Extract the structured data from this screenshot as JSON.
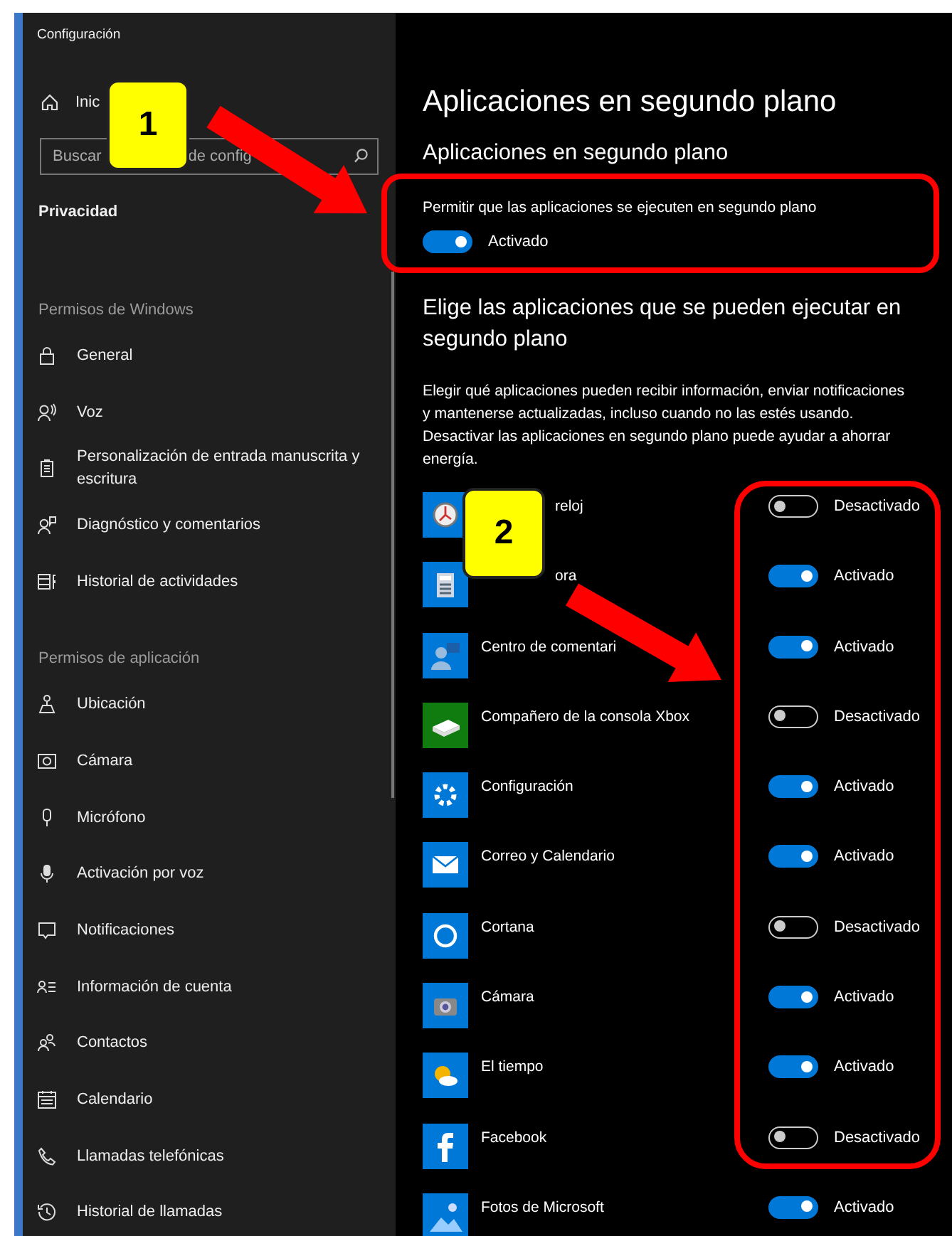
{
  "window": {
    "title": "Configuración"
  },
  "sidebar": {
    "home": {
      "label": "Inic"
    },
    "search": {
      "visible_text": [
        "Buscar",
        "de config"
      ]
    },
    "section": "Privacidad",
    "groups": [
      {
        "heading": "Permisos de Windows",
        "items": [
          "General",
          "Voz",
          "Personalización de entrada manuscrita y escritura",
          "Diagnóstico y comentarios",
          "Historial de actividades"
        ]
      },
      {
        "heading": "Permisos de aplicación",
        "items": [
          "Ubicación",
          "Cámara",
          "Micrófono",
          "Activación por voz",
          "Notificaciones",
          "Información de cuenta",
          "Contactos",
          "Calendario",
          "Llamadas telefónicas",
          "Historial de llamadas"
        ]
      }
    ]
  },
  "main": {
    "title": "Aplicaciones en segundo plano",
    "subtitle": "Aplicaciones en segundo plano",
    "master": {
      "label": "Permitir que las aplicaciones se ejecuten en segundo plano",
      "on": true,
      "state_text": "Activado"
    },
    "heading": "Elige las aplicaciones que se pueden ejecutar en segundo plano",
    "description": "Elegir qué aplicaciones pueden recibir información, enviar notificaciones y mantenerse actualizadas, incluso cuando no las estés usando. Desactivar las aplicaciones en segundo plano puede ayudar a ahorrar energía.",
    "apps": [
      {
        "name": "reloj",
        "covered": true,
        "on": false,
        "state_text": "Desactivado"
      },
      {
        "name": "ora",
        "covered": true,
        "on": true,
        "state_text": "Activado"
      },
      {
        "name": "Centro de comentari",
        "covered": false,
        "on": true,
        "state_text": "Activado"
      },
      {
        "name": "Compañero de la consola Xbox",
        "covered": false,
        "on": false,
        "state_text": "Desactivado"
      },
      {
        "name": "Configuración",
        "covered": false,
        "on": true,
        "state_text": "Activado"
      },
      {
        "name": "Correo y Calendario",
        "covered": false,
        "on": true,
        "state_text": "Activado"
      },
      {
        "name": "Cortana",
        "covered": false,
        "on": false,
        "state_text": "Desactivado"
      },
      {
        "name": "Cámara",
        "covered": false,
        "on": true,
        "state_text": "Activado"
      },
      {
        "name": "El tiempo",
        "covered": false,
        "on": true,
        "state_text": "Activado"
      },
      {
        "name": "Facebook",
        "covered": false,
        "on": false,
        "state_text": "Desactivado"
      },
      {
        "name": "Fotos de Microsoft",
        "covered": false,
        "on": true,
        "state_text": "Activado"
      }
    ]
  },
  "annotations": [
    {
      "number": "1"
    },
    {
      "number": "2"
    }
  ]
}
